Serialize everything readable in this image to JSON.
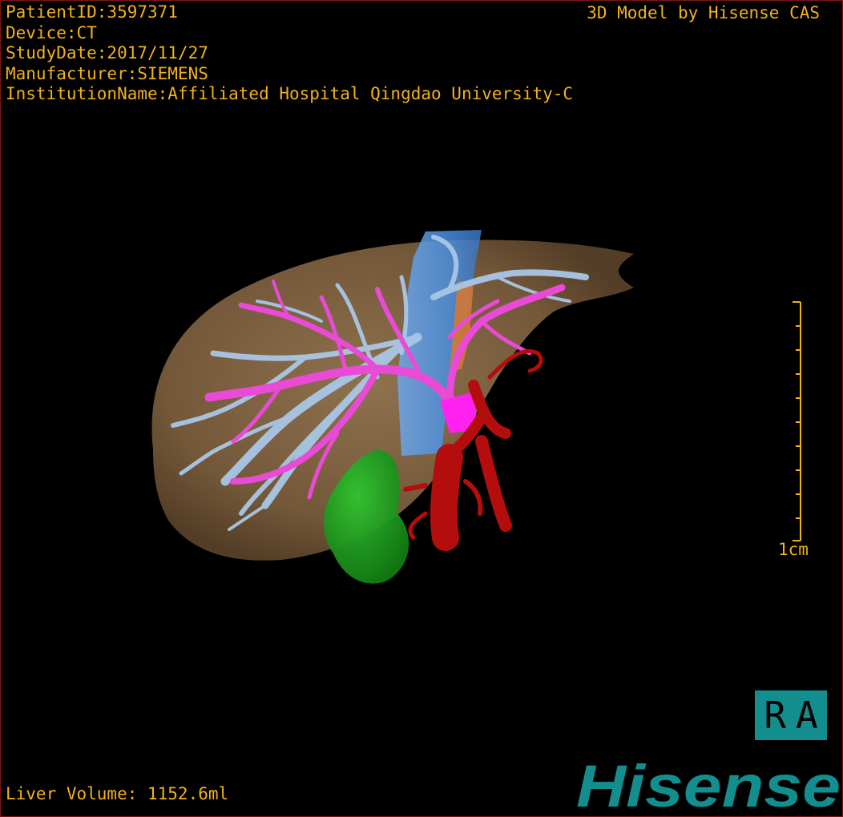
{
  "overlay": {
    "patient_id": "PatientID:3597371",
    "device": "Device:CT",
    "study_date": "StudyDate:2017/11/27",
    "manufacturer": "Manufacturer:SIEMENS",
    "institution": "InstitutionName:Affiliated Hospital Qingdao University-C",
    "credit": "3D Model by Hisense CAS",
    "liver_volume": "Liver Volume: 1152.6ml"
  },
  "scale_bar": {
    "label": "1cm"
  },
  "orientation": {
    "label": "RA"
  },
  "brand": {
    "name": "Hisense"
  },
  "colors": {
    "text": "#f2b21b",
    "liver": "#8a6a45",
    "hepatic_vein": "#a9c7e6",
    "portal_vein": "#e94ad6",
    "artery": "#b30d0d",
    "ivc": "#4a8fe0",
    "gallbladder": "#1fae1f",
    "brand": "#138e8e"
  }
}
